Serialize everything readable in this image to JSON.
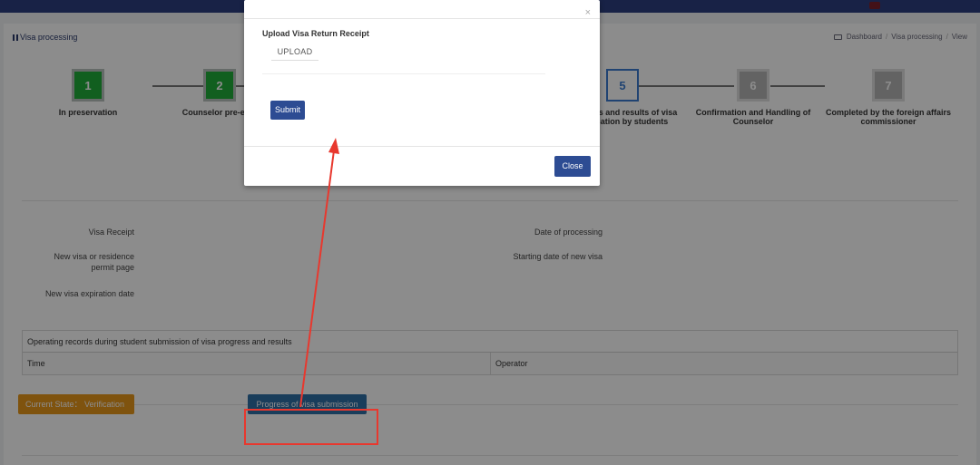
{
  "colors": {
    "topbar": "#2c3e80",
    "step_done": "#1fae3a",
    "step_current": "#3b7bd0",
    "step_todo": "#b5b5b5",
    "state_badge": "#e8971a",
    "progress_button": "#2f6fa7",
    "modal_button": "#2d4c93",
    "annotation": "#e8382e"
  },
  "header": {
    "page_title": "Visa processing",
    "breadcrumb": [
      "Dashboard",
      "Visa processing",
      "View"
    ],
    "breadcrumb_icon": "laptop-icon"
  },
  "steps": [
    {
      "number": "1",
      "label": "In preservation",
      "status": "done"
    },
    {
      "number": "2",
      "label": "Counselor pre-exam",
      "status": "done"
    },
    {
      "number": "5",
      "label": "Progress and results of visa application by students",
      "status": "current"
    },
    {
      "number": "6",
      "label": "Confirmation and Handling of Counselor",
      "status": "todo"
    },
    {
      "number": "7",
      "label": "Completed by the foreign affairs commissioner",
      "status": "todo"
    }
  ],
  "visible_step_label_3": "ess and results of a application by students",
  "visible_step_label_2": "Counselor pre-exar",
  "fields": {
    "visa_receipt": "Visa Receipt",
    "new_visa_page": "New visa or residence permit page",
    "new_visa_expiration": "New visa expiration date",
    "date_of_processing": "Date of processing",
    "starting_date": "Starting date of new visa"
  },
  "records": {
    "caption": "Operating records during student submission of visa progress and results",
    "columns": [
      "Time",
      "Operator"
    ]
  },
  "footer": {
    "current_state": "Current State： Verification",
    "progress_button": "Progress of visa submission"
  },
  "modal": {
    "close_glyph": "×",
    "title": "Upload Visa Return Receipt",
    "upload_label": "UPLOAD",
    "submit_label": "Submit",
    "close_label": "Close"
  }
}
